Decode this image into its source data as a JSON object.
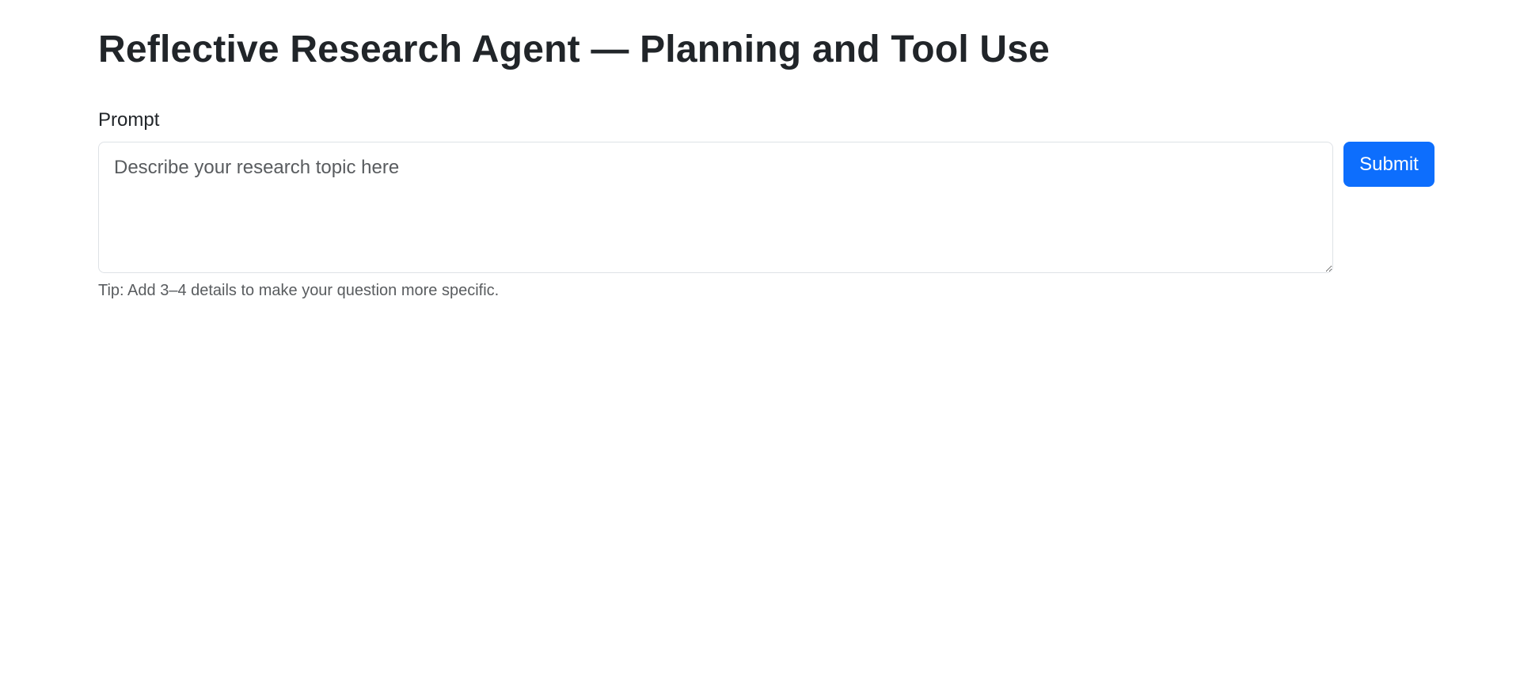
{
  "page": {
    "title": "Reflective Research Agent — Planning and Tool Use"
  },
  "form": {
    "prompt_label": "Prompt",
    "prompt_value": "",
    "prompt_placeholder": "Describe your research topic here",
    "submit_label": "Submit",
    "tip": "Tip: Add 3–4 details to make your question more specific."
  },
  "colors": {
    "accent": "#0d6efd",
    "text": "#212529",
    "muted": "#595c5f",
    "border": "#dee2e6",
    "background": "#ffffff"
  }
}
